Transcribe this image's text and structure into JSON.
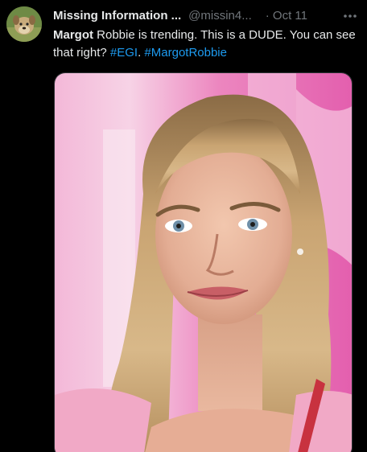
{
  "author": {
    "display_name": "Missing Information ...",
    "handle": "@missin4...",
    "date": "· Oct 11"
  },
  "tweet": {
    "text_parts": {
      "bold_word": "Margot",
      "text_1": " Robbie is trending.    This is a DUDE.  You can see that right? ",
      "hashtag_1": "#EGI",
      "separator": ". ",
      "hashtag_2": "#MargotRobbie"
    }
  },
  "icons": {
    "avatar": "dog-avatar-icon",
    "more": "more-horizontal-icon"
  },
  "colors": {
    "background": "#000000",
    "text": "#e7e9ea",
    "muted": "#71767b",
    "link": "#1d9bf0",
    "media_backdrop": "#e96fb3"
  }
}
